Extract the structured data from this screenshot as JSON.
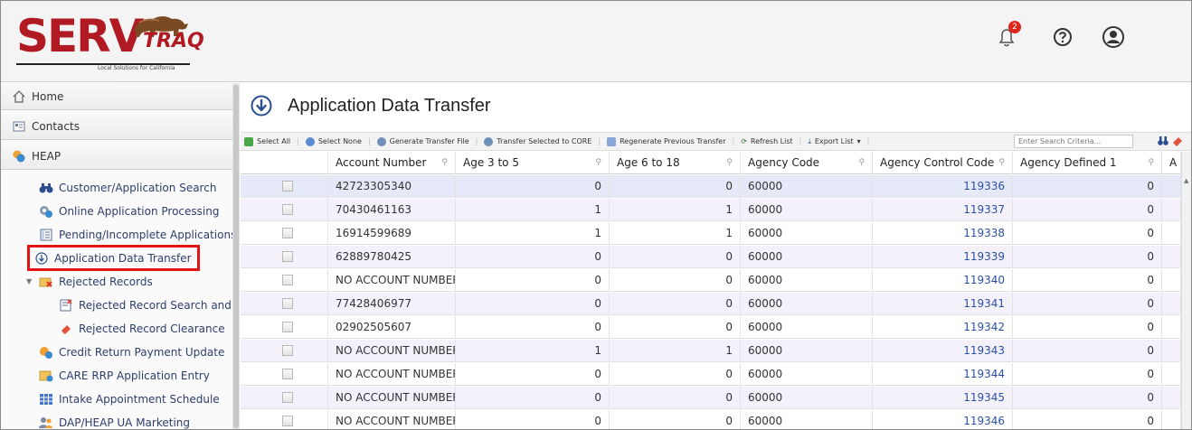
{
  "brand": {
    "logo_word": "SERV",
    "logo_sub": "TRAQ",
    "tagline": "Local Solutions for California",
    "accent": "#b11a22"
  },
  "header": {
    "notification_count": "2",
    "help_icon": "help-icon",
    "user_icon": "user-icon",
    "bell_icon": "bell-icon"
  },
  "sidebar": {
    "top": [
      {
        "label": "Home",
        "icon": "home-icon"
      },
      {
        "label": "Contacts",
        "icon": "contacts-icon"
      },
      {
        "label": "HEAP",
        "icon": "heap-icon"
      }
    ],
    "items": [
      {
        "label": "Customer/Application Search",
        "icon": "binoculars-icon"
      },
      {
        "label": "Online Application Processing",
        "icon": "gears-icon"
      },
      {
        "label": "Pending/Incomplete Applications",
        "icon": "document-list-icon"
      },
      {
        "label": "Application Data Transfer",
        "icon": "download-circle-icon",
        "selected": true
      },
      {
        "label": "Rejected Records",
        "icon": "rejected-records-icon"
      },
      {
        "label": "Rejected Record Search and E",
        "icon": "rejected-search-icon"
      },
      {
        "label": "Rejected Record Clearance",
        "icon": "eraser-icon"
      },
      {
        "label": "Credit Return Payment Update",
        "icon": "gears-icon"
      },
      {
        "label": "CARE RRP Application Entry",
        "icon": "application-entry-icon"
      },
      {
        "label": "Intake Appointment Schedule",
        "icon": "calendar-grid-icon"
      },
      {
        "label": "DAP/HEAP UA Marketing",
        "icon": "people-icon"
      }
    ]
  },
  "page": {
    "title": "Application Data Transfer"
  },
  "toolbar": {
    "buttons": [
      "Select All",
      "Select None",
      "Generate Transfer File",
      "Transfer Selected to CORE",
      "Regenerate Previous Transfer",
      "Refresh List",
      "Export List"
    ],
    "search_placeholder": "Enter Search Criteria..."
  },
  "grid": {
    "columns": [
      "Account Number",
      "Age 3 to 5",
      "Age 6 to 18",
      "Agency Code",
      "Agency Control Code",
      "Agency Defined 1",
      "A"
    ],
    "rows": [
      [
        "42723305340",
        "0",
        "0",
        "60000",
        "119336",
        "0"
      ],
      [
        "70430461163",
        "1",
        "1",
        "60000",
        "119337",
        "0"
      ],
      [
        "16914599689",
        "1",
        "1",
        "60000",
        "119338",
        "0"
      ],
      [
        "62889780425",
        "0",
        "0",
        "60000",
        "119339",
        "0"
      ],
      [
        "NO ACCOUNT NUMBER",
        "0",
        "0",
        "60000",
        "119340",
        "0"
      ],
      [
        "77428406977",
        "0",
        "0",
        "60000",
        "119341",
        "0"
      ],
      [
        "02902505607",
        "0",
        "0",
        "60000",
        "119342",
        "0"
      ],
      [
        "NO ACCOUNT NUMBER",
        "1",
        "1",
        "60000",
        "119343",
        "0"
      ],
      [
        "NO ACCOUNT NUMBER",
        "0",
        "0",
        "60000",
        "119344",
        "0"
      ],
      [
        "NO ACCOUNT NUMBER",
        "0",
        "0",
        "60000",
        "119345",
        "0"
      ],
      [
        "NO ACCOUNT NUMBER",
        "0",
        "0",
        "60000",
        "119346",
        "0"
      ]
    ]
  }
}
